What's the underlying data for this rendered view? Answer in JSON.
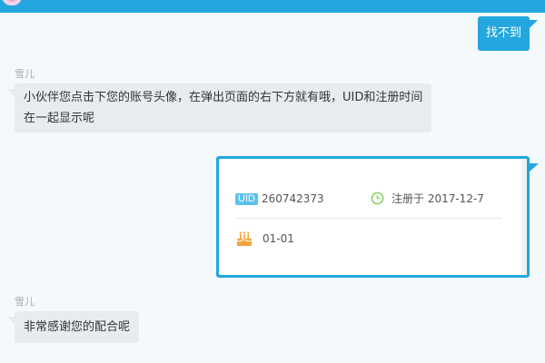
{
  "chat": {
    "user_msg_1": "找不到",
    "agent_name": "雪儿",
    "agent_msg_1_line1": "小伙伴您点击下您的账号头像，在弹出页面的右下方就有哦，UID和注册时间",
    "agent_msg_1_line2": "在一起显示呢",
    "agent_msg_2": "非常感谢您的配合呢"
  },
  "profile_card": {
    "uid_label": "UID",
    "uid_value": "260742373",
    "register_text": "注册于 2017-12-7",
    "birthday": "01-01"
  },
  "colors": {
    "accent": "#23a7de",
    "agent_bubble": "#e8ecef",
    "clock_green": "#8ed46b",
    "cake_orange": "#f2a33a"
  },
  "icons": [
    "clock-icon",
    "cake-icon"
  ]
}
